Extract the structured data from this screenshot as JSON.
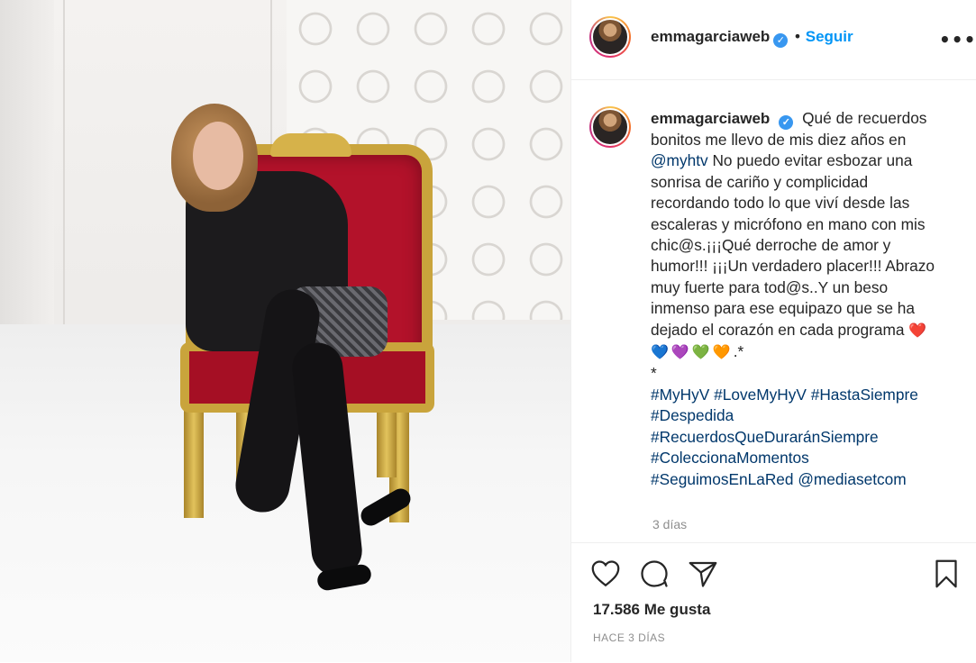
{
  "post": {
    "username": "emmagarciaweb",
    "verified_glyph": "✓",
    "separator": "•",
    "follow_label": "Seguir",
    "more_label": "•••",
    "caption_intro": "Qué de recuerdos bonitos me llevo de mis diez años en",
    "mention_myhtv": "@myhtv",
    "caption_body": "No puedo evitar esbozar una sonrisa de cariño y complicidad recordando todo lo que viví desde las escaleras y micrófono en mano con mis chic@s.¡¡¡Qué derroche de amor y humor!!! ¡¡¡Un verdadero placer!!! Abrazo muy fuerte para tod@s..Y un beso inmenso para ese equipazo que se ha dejado el corazón en cada programa",
    "hearts": [
      "❤️",
      "💙",
      "💜",
      "💚",
      "🧡"
    ],
    "caption_end": ".*",
    "asterisk": "*",
    "hashtags": [
      "#MyHyV",
      "#LoveMyHyV",
      "#HastaSiempre",
      "#Despedida",
      "#RecuerdosQueDuraránSiempre",
      "#ColeccionaMomentos",
      "#SeguimosEnLaRed"
    ],
    "mention_mediaset": "@mediasetcom",
    "comment_time": "3 días",
    "likes": "17.586 Me gusta",
    "posted_ago": "HACE 3 DÍAS"
  },
  "icons": {
    "like": "heart-icon",
    "comment": "comment-icon",
    "share": "share-icon",
    "save": "bookmark-icon"
  },
  "colors": {
    "link": "#00376b",
    "follow": "#0095f6",
    "verified": "#3897f0",
    "muted": "#8e8e8e"
  }
}
